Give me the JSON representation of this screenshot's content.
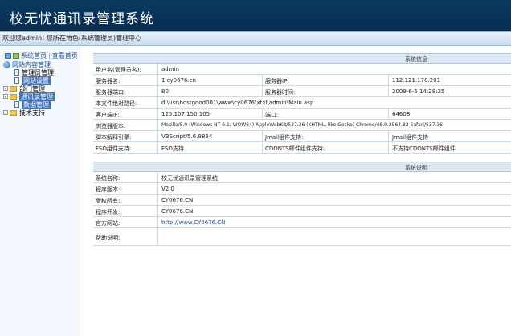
{
  "header": {
    "title": "校无忧通讯录管理系统"
  },
  "welcome": {
    "text": "欢迎您admin! 您所在角色(系统管理员)管理中心"
  },
  "sidebar": {
    "home_label": "系统首页",
    "back_label": "查看首页",
    "items": [
      {
        "label": "网站内容管理",
        "level": 0,
        "icon": "globe-icon"
      },
      {
        "label": "管理员管理",
        "level": 1,
        "icon": "page-icon"
      },
      {
        "label": "网站设置",
        "level": 1,
        "icon": "page-icon"
      },
      {
        "label": "部门管理",
        "level": 0,
        "icon": "folder-icon"
      },
      {
        "label": "通讯录管理",
        "level": 0,
        "icon": "folder-icon"
      },
      {
        "label": "数据管理",
        "level": 1,
        "icon": "page-icon"
      },
      {
        "label": "技术支持",
        "level": 0,
        "icon": "folder-icon"
      }
    ]
  },
  "server_info": {
    "heading": "系统信息",
    "rows": [
      {
        "label": "用户名(管理员名):",
        "value": "admin"
      },
      {
        "label": "服务器名:",
        "value": "1 cy0676.cn",
        "label2": "服务器IP:",
        "value2": "112.121.178.201"
      },
      {
        "label": "服务器端口:",
        "value": "80",
        "label2": "服务器时间:",
        "value2": "2009-6-5 14:28:25"
      },
      {
        "label": "本文件绝对路径:",
        "value": "d:\\usr\\hostgood001\\www\\cy0676\\xtxl\\admin\\Main.asp"
      },
      {
        "label": "客户端IP:",
        "value": "125.107.150.105",
        "label2": "端口:",
        "value2": "64608"
      },
      {
        "label": "浏览器版本:",
        "value": "Mozilla/5.0 (Windows NT 6.1; WOW64) AppleWebKit/537.36 (KHTML, like Gecko) Chrome/48.0.2564.82 Safari/537.36"
      },
      {
        "label": "脚本解释引擎:",
        "value": "VBScript/5.6.8834",
        "label2": "Jmail组件支持:",
        "value2": "Jmail组件支持"
      },
      {
        "label": "FSO组件支持:",
        "value": "FSO支持",
        "label2": "CDONTS邮件组件支持:",
        "value2": "不支持CDONTS邮件组件"
      }
    ]
  },
  "system_info": {
    "heading": "系统说明",
    "rows": [
      {
        "label": "系统名称:",
        "value": "校无忧通讯录管理系统"
      },
      {
        "label": "程序版本:",
        "value": "V2.0"
      },
      {
        "label": "版权所有:",
        "value": "CY0676.CN"
      },
      {
        "label": "程序开发:",
        "value": "CY0676.CN"
      },
      {
        "label": "官方网站:",
        "value": "http://www.CY0676.CN"
      },
      {
        "label": "帮助说明:",
        "value": ""
      }
    ]
  }
}
